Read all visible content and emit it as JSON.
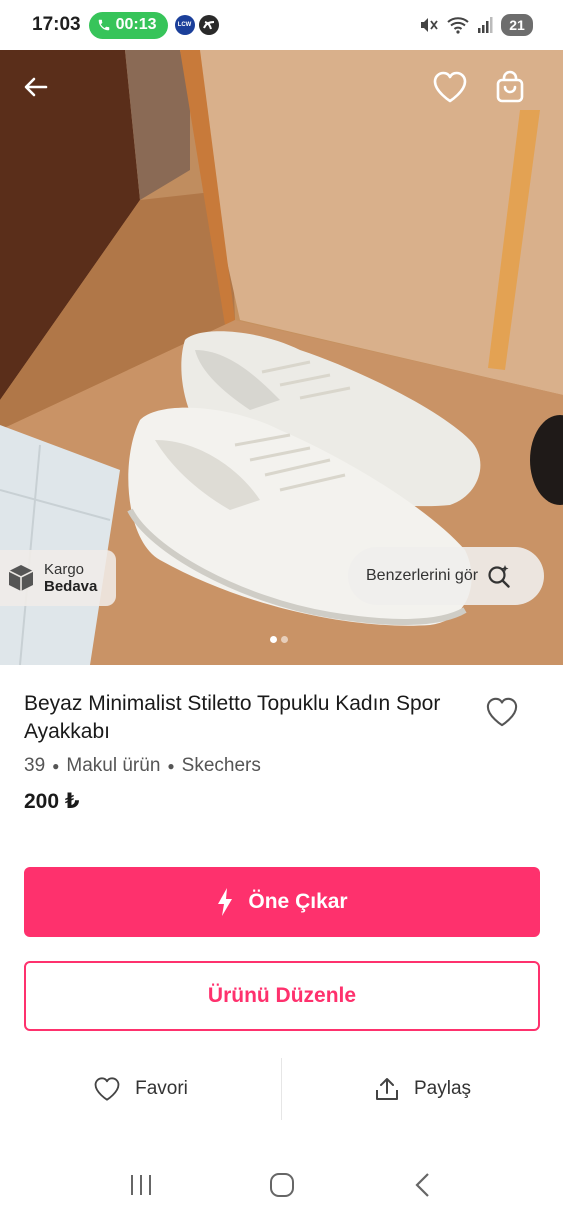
{
  "status_bar": {
    "time": "17:03",
    "call_timer": "00:13",
    "app_badge": "LCW",
    "battery": "21"
  },
  "hero": {
    "icons": [
      "back-arrow-icon",
      "heart-icon",
      "shopping-bag-icon"
    ],
    "kargo_badge": {
      "line1": "Kargo",
      "line2": "Bedava"
    },
    "similar_button": "Benzerlerini gör",
    "image_count": 2,
    "active_image": 1
  },
  "product": {
    "title": "Beyaz Minimalist Stiletto Topuklu Kadın Spor Ayakkabı",
    "size": "39",
    "condition": "Makul ürün",
    "brand": "Skechers",
    "price": "200 ₺"
  },
  "buttons": {
    "promote": "Öne Çıkar",
    "edit": "Ürünü Düzenle"
  },
  "actions": {
    "favorite": "Favori",
    "share": "Paylaş"
  },
  "colors": {
    "accent": "#fe316d",
    "call_green": "#37c45a"
  }
}
